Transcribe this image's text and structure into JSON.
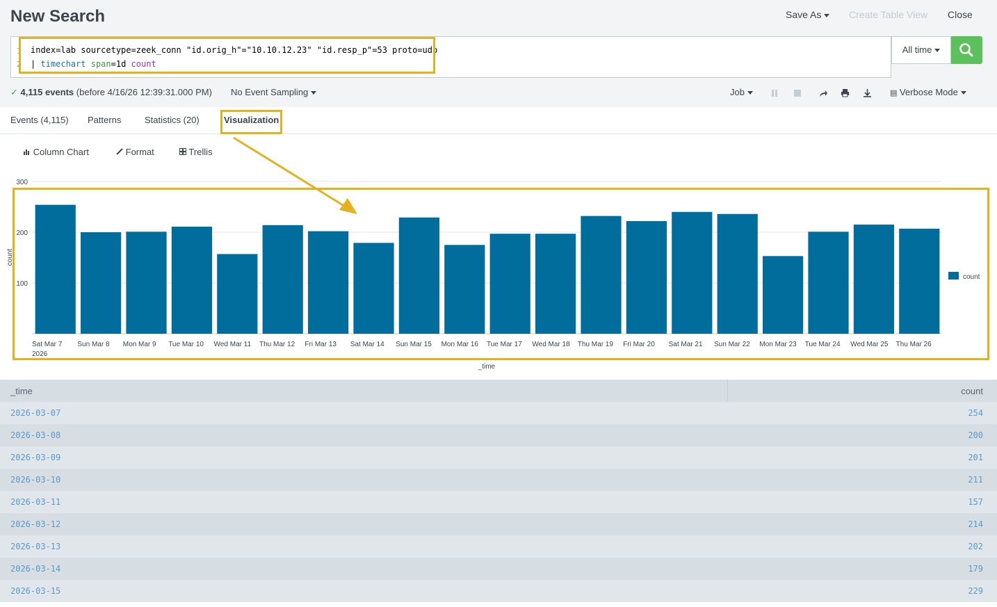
{
  "header": {
    "title": "New Search",
    "save_as": "Save As",
    "create_table_view": "Create Table View",
    "close": "Close"
  },
  "search": {
    "line1_no": "1",
    "line2_no": "2",
    "line1": "index=lab sourcetype=zeek_conn \"id.orig_h\"=\"10.10.12.23\" \"id.resp_p\"=53 proto=udp",
    "line2_pipe": "| ",
    "line2_cmd": "timechart",
    "line2_arg": "span",
    "line2_val": "=1d ",
    "line2_fn": "count",
    "time_range": "All time"
  },
  "status": {
    "check": "✓",
    "events": "4,115 events",
    "before": "(before 4/16/26 12:39:31.000 PM)",
    "sampling": "No Event Sampling",
    "job": "Job",
    "mode": "Verbose Mode"
  },
  "tabs": [
    "Events (4,115)",
    "Patterns",
    "Statistics (20)",
    "Visualization"
  ],
  "viz_toolbar": {
    "chart_type": "Column Chart",
    "format": "Format",
    "trellis": "Trellis"
  },
  "colors": {
    "bar": "#006d9c",
    "highlight": "#e6b11e",
    "search_button": "#5cc05c"
  },
  "chart_data": {
    "type": "bar",
    "xlabel": "_time",
    "ylabel": "count",
    "ylim": [
      0,
      300
    ],
    "yticks": [
      100,
      200,
      300
    ],
    "year_label": "2026",
    "categories": [
      "Sat Mar 7",
      "Sun Mar 8",
      "Mon Mar 9",
      "Tue Mar 10",
      "Wed Mar 11",
      "Thu Mar 12",
      "Fri Mar 13",
      "Sat Mar 14",
      "Sun Mar 15",
      "Mon Mar 16",
      "Tue Mar 17",
      "Wed Mar 18",
      "Thu Mar 19",
      "Fri Mar 20",
      "Sat Mar 21",
      "Sun Mar 22",
      "Mon Mar 23",
      "Tue Mar 24",
      "Wed Mar 25",
      "Thu Mar 26"
    ],
    "series": [
      {
        "name": "count",
        "values": [
          254,
          200,
          201,
          211,
          157,
          214,
          202,
          179,
          229,
          175,
          197,
          197,
          232,
          222,
          240,
          236,
          153,
          201,
          215,
          207
        ]
      }
    ],
    "legend": "right"
  },
  "table": {
    "columns": [
      "_time",
      "count"
    ],
    "rows": [
      [
        "2026-03-07",
        "254"
      ],
      [
        "2026-03-08",
        "200"
      ],
      [
        "2026-03-09",
        "201"
      ],
      [
        "2026-03-10",
        "211"
      ],
      [
        "2026-03-11",
        "157"
      ],
      [
        "2026-03-12",
        "214"
      ],
      [
        "2026-03-13",
        "202"
      ],
      [
        "2026-03-14",
        "179"
      ],
      [
        "2026-03-15",
        "229"
      ]
    ]
  }
}
